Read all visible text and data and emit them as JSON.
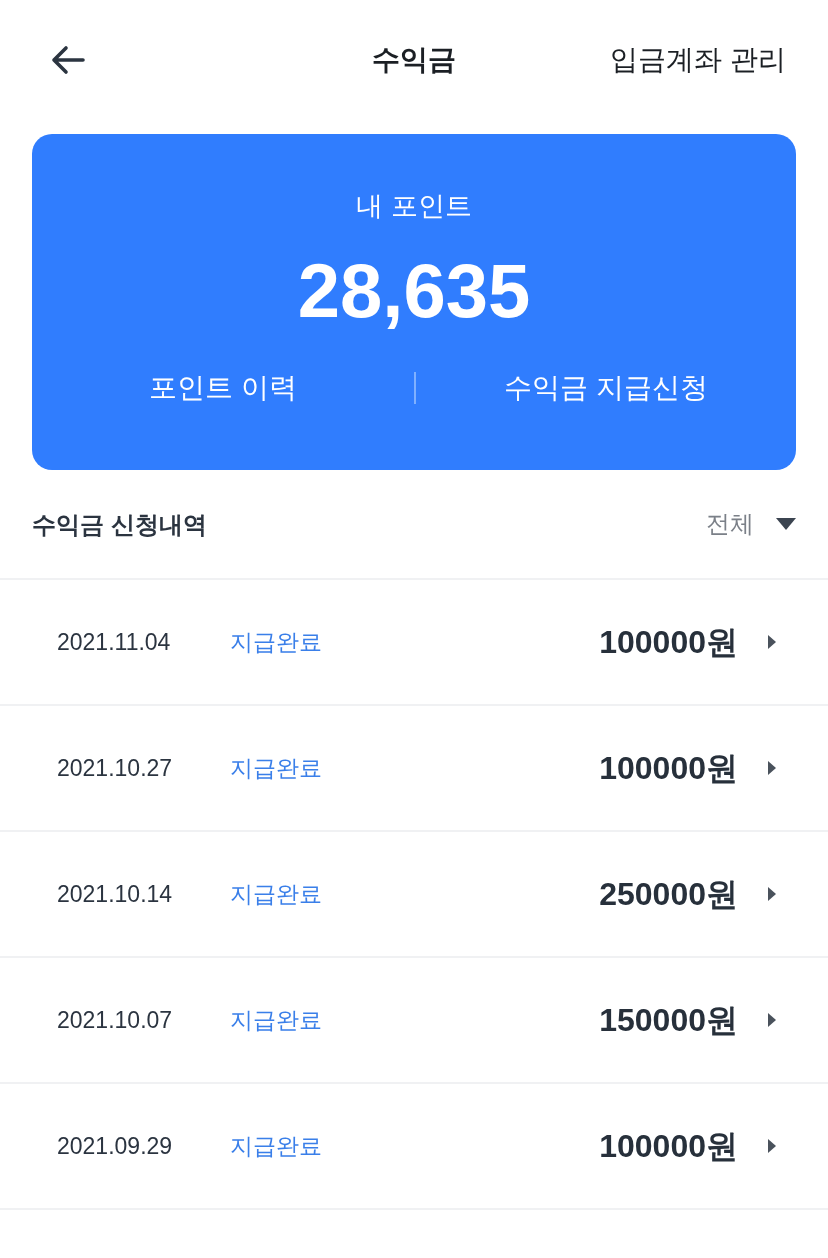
{
  "header": {
    "title": "수익금",
    "action": "입금계좌 관리"
  },
  "points_card": {
    "label": "내 포인트",
    "value": "28,635",
    "actions": [
      "포인트 이력",
      "수익금 지급신청"
    ]
  },
  "history": {
    "title": "수익금 신청내역",
    "filter": "전체"
  },
  "rows": [
    {
      "date": "2021.11.04",
      "status": "지급완료",
      "amount": "100000원"
    },
    {
      "date": "2021.10.27",
      "status": "지급완료",
      "amount": "100000원"
    },
    {
      "date": "2021.10.14",
      "status": "지급완료",
      "amount": "250000원"
    },
    {
      "date": "2021.10.07",
      "status": "지급완료",
      "amount": "150000원"
    },
    {
      "date": "2021.09.29",
      "status": "지급완료",
      "amount": "100000원"
    }
  ]
}
